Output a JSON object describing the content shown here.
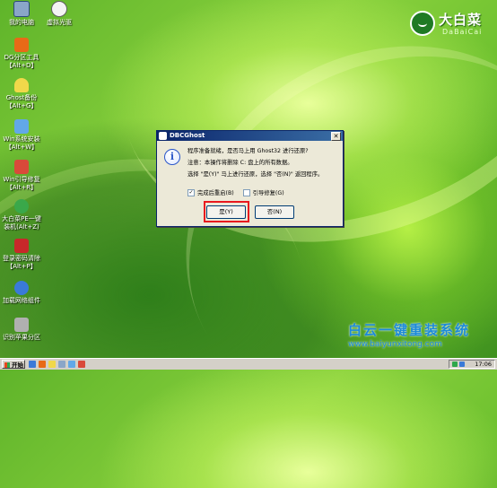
{
  "desktop": {
    "icons": [
      {
        "name": "my-computer",
        "label": "我的电脑",
        "label2": "",
        "color": "#8aa6c8"
      },
      {
        "name": "virtual-cdrom",
        "label": "虚拟光驱",
        "label2": "",
        "color": "#e6e6e6"
      },
      {
        "name": "dg-partition",
        "label": "DG分区工具",
        "label2": "【Alt+D】",
        "color": "#e86a17"
      },
      {
        "name": "ghost-backup",
        "label": "Ghost备份",
        "label2": "【Alt+G】",
        "color": "#f0d84a"
      },
      {
        "name": "win-install",
        "label": "Win系统安装",
        "label2": "【Alt+W】",
        "color": "#62a8e8"
      },
      {
        "name": "win-repair",
        "label": "Win引导修复",
        "label2": "【Alt+R】",
        "color": "#d94a3a"
      },
      {
        "name": "dabaicai-pe",
        "label": "大白菜PE一键",
        "label2": "装机(Alt+Z)",
        "color": "#3aa84a"
      },
      {
        "name": "password-clear",
        "label": "登录密码清除",
        "label2": "【Alt+P】",
        "color": "#c8282a"
      },
      {
        "name": "load-network",
        "label": "加载网络组件",
        "label2": "",
        "color": "#3a7ad8"
      },
      {
        "name": "usb-partition",
        "label": "识别苹果分区",
        "label2": "",
        "color": "#b0b0b0"
      }
    ]
  },
  "logo": {
    "name": "大白菜",
    "sub": "DaBaiCai"
  },
  "dialog": {
    "title": "DBCGhost",
    "close": "✕",
    "icon_glyph": "i",
    "messages": [
      "程序准备就绪，是否马上用 Ghost32 进行还原?",
      "注意：本操作将删除 C: 盘上的所有数据。",
      "选择 \"是(Y)\" 马上进行还原，选择 \"否(N)\" 返回程序。"
    ],
    "options": [
      {
        "label": "完成后重启(B)",
        "checked": true,
        "mark": "✓"
      },
      {
        "label": "引导修复(G)",
        "checked": false,
        "mark": ""
      }
    ],
    "buttons": {
      "yes": "是(Y)",
      "no": "否(N)"
    }
  },
  "watermark": {
    "title": "白云一键重装系统",
    "url": "www.baiyunxitong.com"
  },
  "taskbar": {
    "start_label": "开始",
    "clock": "17:06"
  }
}
